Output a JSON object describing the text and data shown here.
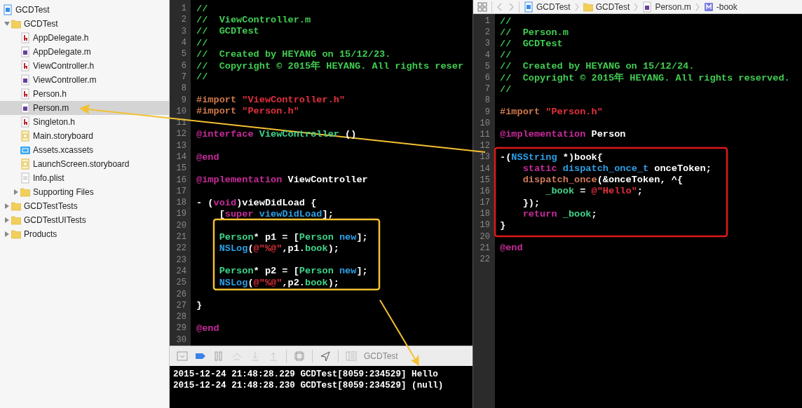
{
  "navigator": {
    "items": [
      {
        "label": "GCDTest",
        "kind": "project",
        "selected": false
      },
      {
        "label": "GCDTest",
        "kind": "folder",
        "selected": false,
        "expanded": true,
        "children": [
          {
            "label": "AppDelegate.h",
            "kind": "header",
            "selected": false
          },
          {
            "label": "AppDelegate.m",
            "kind": "impl",
            "selected": false
          },
          {
            "label": "ViewController.h",
            "kind": "header",
            "selected": false
          },
          {
            "label": "ViewController.m",
            "kind": "impl",
            "selected": false
          },
          {
            "label": "Person.h",
            "kind": "header",
            "selected": false
          },
          {
            "label": "Person.m",
            "kind": "impl",
            "selected": true
          },
          {
            "label": "Singleton.h",
            "kind": "header",
            "selected": false
          },
          {
            "label": "Main.storyboard",
            "kind": "storyboard",
            "selected": false
          },
          {
            "label": "Assets.xcassets",
            "kind": "assets",
            "selected": false
          },
          {
            "label": "LaunchScreen.storyboard",
            "kind": "storyboard",
            "selected": false
          },
          {
            "label": "Info.plist",
            "kind": "plist",
            "selected": false
          },
          {
            "label": "Supporting Files",
            "kind": "folder",
            "selected": false,
            "expanded": false
          }
        ]
      },
      {
        "label": "GCDTestTests",
        "kind": "folder",
        "selected": false,
        "expanded": false
      },
      {
        "label": "GCDTestUITests",
        "kind": "folder",
        "selected": false,
        "expanded": false
      },
      {
        "label": "Products",
        "kind": "folder",
        "selected": false,
        "expanded": false
      }
    ]
  },
  "left_editor": {
    "lines": [
      {
        "number": "1",
        "tokens": [
          {
            "kind": "comment",
            "text": "//"
          }
        ]
      },
      {
        "number": "2",
        "tokens": [
          {
            "kind": "comment",
            "text": "//  ViewController.m"
          }
        ]
      },
      {
        "number": "3",
        "tokens": [
          {
            "kind": "comment",
            "text": "//  GCDTest"
          }
        ]
      },
      {
        "number": "4",
        "tokens": [
          {
            "kind": "comment",
            "text": "//"
          }
        ]
      },
      {
        "number": "5",
        "tokens": [
          {
            "kind": "comment",
            "text": "//  Created by HEYANG on 15/12/23."
          }
        ]
      },
      {
        "number": "6",
        "tokens": [
          {
            "kind": "comment",
            "text": "//  Copyright © 2015年 HEYANG. All rights reser"
          }
        ]
      },
      {
        "number": "7",
        "tokens": [
          {
            "kind": "comment",
            "text": "//"
          }
        ]
      },
      {
        "number": "8"
      },
      {
        "number": "9",
        "tokens": [
          {
            "kind": "preproc",
            "text": "#import "
          },
          {
            "kind": "string",
            "text": "\"ViewController.h\""
          }
        ]
      },
      {
        "number": "10",
        "tokens": [
          {
            "kind": "preproc",
            "text": "#import "
          },
          {
            "kind": "string",
            "text": "\"Person.h\""
          }
        ]
      },
      {
        "number": "11"
      },
      {
        "number": "12",
        "tokens": [
          {
            "kind": "keyword",
            "text": "@interface"
          },
          {
            "kind": "project",
            "text": " ViewController"
          },
          {
            "kind": "plain",
            "text": " ()"
          }
        ]
      },
      {
        "number": "13"
      },
      {
        "number": "14",
        "tokens": [
          {
            "kind": "keyword",
            "text": "@end"
          }
        ]
      },
      {
        "number": "15"
      },
      {
        "number": "16",
        "tokens": [
          {
            "kind": "keyword",
            "text": "@implementation"
          },
          {
            "kind": "plain",
            "text": " ViewController"
          }
        ]
      },
      {
        "number": "17"
      },
      {
        "number": "18",
        "tokens": [
          {
            "kind": "plain",
            "text": "- ("
          },
          {
            "kind": "keyword",
            "text": "void"
          },
          {
            "kind": "plain",
            "text": ")viewDidLoad {"
          }
        ]
      },
      {
        "number": "19",
        "tokens": [
          {
            "kind": "plain",
            "text": "    ["
          },
          {
            "kind": "keyword",
            "text": "super"
          },
          {
            "kind": "system",
            "text": " viewDidLoad"
          },
          {
            "kind": "plain",
            "text": "];"
          }
        ]
      },
      {
        "number": "20"
      },
      {
        "number": "21",
        "tokens": [
          {
            "kind": "project",
            "text": "    Person"
          },
          {
            "kind": "plain",
            "text": "* p1 = ["
          },
          {
            "kind": "project",
            "text": "Person"
          },
          {
            "kind": "system",
            "text": " new"
          },
          {
            "kind": "plain",
            "text": "];"
          }
        ]
      },
      {
        "number": "22",
        "tokens": [
          {
            "kind": "system",
            "text": "    NSLog"
          },
          {
            "kind": "plain",
            "text": "("
          },
          {
            "kind": "string",
            "text": "@\"%@\""
          },
          {
            "kind": "plain",
            "text": ",p1."
          },
          {
            "kind": "project",
            "text": "book"
          },
          {
            "kind": "plain",
            "text": ");"
          }
        ]
      },
      {
        "number": "23"
      },
      {
        "number": "24",
        "tokens": [
          {
            "kind": "project",
            "text": "    Person"
          },
          {
            "kind": "plain",
            "text": "* p2 = ["
          },
          {
            "kind": "project",
            "text": "Person"
          },
          {
            "kind": "system",
            "text": " new"
          },
          {
            "kind": "plain",
            "text": "];"
          }
        ]
      },
      {
        "number": "25",
        "tokens": [
          {
            "kind": "system",
            "text": "    NSLog"
          },
          {
            "kind": "plain",
            "text": "("
          },
          {
            "kind": "string",
            "text": "@\"%@\""
          },
          {
            "kind": "plain",
            "text": ",p2."
          },
          {
            "kind": "project",
            "text": "book"
          },
          {
            "kind": "plain",
            "text": ");"
          }
        ]
      },
      {
        "number": "26"
      },
      {
        "number": "27",
        "tokens": [
          {
            "kind": "plain",
            "text": "}"
          }
        ]
      },
      {
        "number": "28"
      },
      {
        "number": "29",
        "tokens": [
          {
            "kind": "keyword",
            "text": "@end"
          }
        ]
      },
      {
        "number": "30"
      }
    ]
  },
  "debug_bar": {
    "target": "GCDTest"
  },
  "console": {
    "lines": [
      "2015-12-24 21:48:28.229 GCDTest[8059:234529] Hello",
      "2015-12-24 21:48:28.230 GCDTest[8059:234529] (null)"
    ]
  },
  "jump_bar": {
    "crumbs": [
      {
        "kind": "project",
        "label": "GCDTest"
      },
      {
        "kind": "folder",
        "label": "GCDTest"
      },
      {
        "kind": "impl",
        "label": "Person.m"
      },
      {
        "kind": "method",
        "label": "-book"
      }
    ]
  },
  "right_editor": {
    "lines": [
      {
        "number": "1",
        "tokens": [
          {
            "kind": "comment",
            "text": "//"
          }
        ]
      },
      {
        "number": "2",
        "tokens": [
          {
            "kind": "comment",
            "text": "//  Person.m"
          }
        ]
      },
      {
        "number": "3",
        "tokens": [
          {
            "kind": "comment",
            "text": "//  GCDTest"
          }
        ]
      },
      {
        "number": "4",
        "tokens": [
          {
            "kind": "comment",
            "text": "//"
          }
        ]
      },
      {
        "number": "5",
        "tokens": [
          {
            "kind": "comment",
            "text": "//  Created by HEYANG on 15/12/24."
          }
        ]
      },
      {
        "number": "6",
        "tokens": [
          {
            "kind": "comment",
            "text": "//  Copyright © 2015年 HEYANG. All rights reserved."
          }
        ]
      },
      {
        "number": "7",
        "tokens": [
          {
            "kind": "comment",
            "text": "//"
          }
        ]
      },
      {
        "number": "8"
      },
      {
        "number": "9",
        "tokens": [
          {
            "kind": "preproc",
            "text": "#import "
          },
          {
            "kind": "string",
            "text": "\"Person.h\""
          }
        ]
      },
      {
        "number": "10"
      },
      {
        "number": "11",
        "tokens": [
          {
            "kind": "keyword",
            "text": "@implementation"
          },
          {
            "kind": "plain",
            "text": " Person"
          }
        ]
      },
      {
        "number": "12"
      },
      {
        "number": "13",
        "tokens": [
          {
            "kind": "plain",
            "text": "-("
          },
          {
            "kind": "system",
            "text": "NSString"
          },
          {
            "kind": "plain",
            "text": " *)book{"
          }
        ]
      },
      {
        "number": "14",
        "tokens": [
          {
            "kind": "keyword",
            "text": "    static"
          },
          {
            "kind": "system",
            "text": " dispatch_once_t"
          },
          {
            "kind": "plain",
            "text": " onceToken;"
          }
        ]
      },
      {
        "number": "15",
        "tokens": [
          {
            "kind": "macro",
            "text": "    dispatch_once"
          },
          {
            "kind": "plain",
            "text": "(&onceToken, ^{"
          }
        ]
      },
      {
        "number": "16",
        "tokens": [
          {
            "kind": "project",
            "text": "        _book"
          },
          {
            "kind": "plain",
            "text": " = "
          },
          {
            "kind": "string",
            "text": "@\"Hello\""
          },
          {
            "kind": "plain",
            "text": ";"
          }
        ]
      },
      {
        "number": "17",
        "tokens": [
          {
            "kind": "plain",
            "text": "    });"
          }
        ]
      },
      {
        "number": "18",
        "tokens": [
          {
            "kind": "keyword",
            "text": "    return"
          },
          {
            "kind": "project",
            "text": " _book"
          },
          {
            "kind": "plain",
            "text": ";"
          }
        ]
      },
      {
        "number": "19",
        "tokens": [
          {
            "kind": "plain",
            "text": "}"
          }
        ]
      },
      {
        "number": "20"
      },
      {
        "number": "21",
        "tokens": [
          {
            "kind": "keyword",
            "text": "@end"
          }
        ]
      },
      {
        "number": "22"
      }
    ]
  }
}
